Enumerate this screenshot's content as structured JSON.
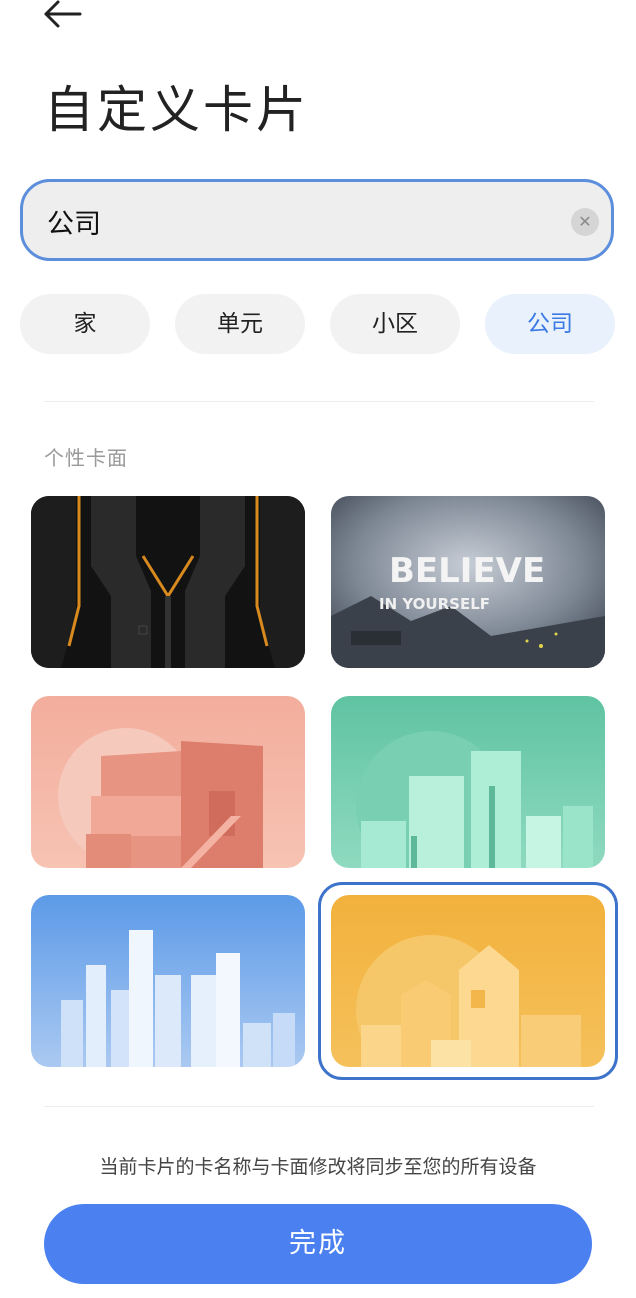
{
  "header": {
    "title": "自定义卡片",
    "back_icon": "arrow-left-icon"
  },
  "name_input": {
    "value": "公司",
    "placeholder": "",
    "clear_icon": "clear-icon"
  },
  "chips": [
    {
      "label": "家",
      "selected": false
    },
    {
      "label": "单元",
      "selected": false
    },
    {
      "label": "小区",
      "selected": false
    },
    {
      "label": "公司",
      "selected": true
    }
  ],
  "section": {
    "label": "个性卡面"
  },
  "cards": [
    {
      "name": "dark-tech",
      "selected": false
    },
    {
      "name": "believe",
      "selected": false,
      "text_line1": "BELIEVE",
      "text_line2": "IN YOURSELF"
    },
    {
      "name": "coral-building",
      "selected": false
    },
    {
      "name": "mint-city",
      "selected": false
    },
    {
      "name": "blue-skyline",
      "selected": false
    },
    {
      "name": "yellow-houses",
      "selected": true
    }
  ],
  "footer": {
    "notice": "当前卡片的卡名称与卡面修改将同步至您的所有设备",
    "done_label": "完成"
  },
  "colors": {
    "accent": "#4a80f0",
    "selected_border": "#3e73cc",
    "chip_active_bg": "#e9f1fc"
  }
}
